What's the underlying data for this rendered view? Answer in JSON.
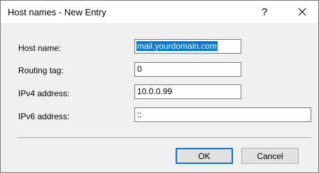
{
  "window": {
    "title": "Host names - New Entry",
    "help_label": "?"
  },
  "form": {
    "host_name": {
      "label": "Host name:",
      "value": "mail.yourdomain.com"
    },
    "routing_tag": {
      "label": "Routing tag:",
      "value": "0"
    },
    "ipv4": {
      "label": "IPv4 address:",
      "value": "10.0.0.99"
    },
    "ipv6": {
      "label": "IPv6 address:",
      "value": "::"
    }
  },
  "buttons": {
    "ok_label": "OK",
    "cancel_label": "Cancel"
  },
  "colors": {
    "accent": "#0078d7",
    "selection_text": "#ffffff"
  },
  "icons": {
    "close": "close-icon",
    "help": "help-icon"
  }
}
